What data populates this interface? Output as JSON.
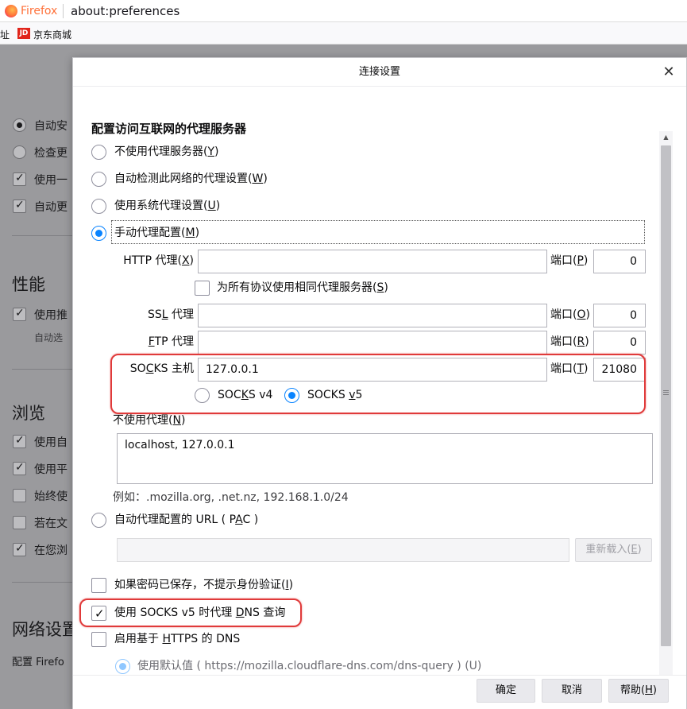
{
  "browser": {
    "brand": "Firefox",
    "url": "about:preferences",
    "bookmark_left": "址",
    "bookmark_jd_icon": "JD",
    "bookmark_jd": "京东商城"
  },
  "background": {
    "items": [
      "自动安",
      "检查更",
      "使用一",
      "自动更"
    ],
    "perf_heading": "性能",
    "perf_item": "使用推",
    "perf_sub": "自动选",
    "browse_heading": "浏览",
    "browse_items": [
      "使用自",
      "使用平",
      "始终使",
      "若在文",
      "在您浏"
    ],
    "net_heading": "网络设置",
    "net_text": "配置 Firefo"
  },
  "dialog": {
    "title": "连接设置",
    "close_glyph": "✕",
    "heading": "配置访问互联网的代理服务器",
    "options": {
      "no_proxy": {
        "text": "不使用代理服务器(",
        "key": "Y",
        "end": ")"
      },
      "auto_detect": {
        "text": "自动检测此网络的代理设置(",
        "key": "W",
        "end": ")"
      },
      "system": {
        "text": "使用系统代理设置(",
        "key": "U",
        "end": ")"
      },
      "manual": {
        "text": "手动代理配置(",
        "key": "M",
        "end": ")"
      }
    },
    "http": {
      "label_a": "HTTP 代理(",
      "key": "X",
      "label_b": ")",
      "host": "",
      "port_label_a": "端口(",
      "port_key": "P",
      "port_label_b": ")",
      "port": "0"
    },
    "same_proxy": {
      "text": "为所有协议使用相同代理服务器(",
      "key": "S",
      "end": ")"
    },
    "ssl": {
      "label_a": "SS",
      "key": "L",
      "label_b": " 代理",
      "host": "",
      "port_label_a": "端口(",
      "port_key": "O",
      "port_label_b": ")",
      "port": "0"
    },
    "ftp": {
      "label_a": "",
      "key": "F",
      "label_b": "TP 代理",
      "host": "",
      "port_label_a": "端口(",
      "port_key": "R",
      "port_label_b": ")",
      "port": "0"
    },
    "socks": {
      "label_a": "SO",
      "key": "C",
      "label_b": "KS 主机",
      "host": "127.0.0.1",
      "port_label_a": "端口(",
      "port_key": "T",
      "port_label_b": ")",
      "port": "21080"
    },
    "socks_v4": {
      "a": "SOC",
      "key": "K",
      "b": "S v4"
    },
    "socks_v5": {
      "a": "SOCKS ",
      "key": "v",
      "b": "5"
    },
    "no_proxy_for": {
      "text": "不使用代理(",
      "key": "N",
      "end": ")"
    },
    "no_proxy_value": "localhost, 127.0.0.1",
    "example": "例如：.mozilla.org, .net.nz, 192.168.1.0/24",
    "pac": {
      "text": "自动代理配置的 URL ( P",
      "key": "A",
      "end": "C )"
    },
    "pac_value": "",
    "reload": {
      "text": "重新载入(",
      "key": "E",
      "end": ")"
    },
    "no_auth_prompt": {
      "text": "如果密码已保存，不提示身份验证(",
      "key": "I",
      "end": ")"
    },
    "socks_dns": {
      "a": "使用 SOCKS v5 时代理 ",
      "key": "D",
      "b": "NS 查询"
    },
    "doh": {
      "a": "启用基于 ",
      "key": "H",
      "b": "TTPS 的 DNS"
    },
    "doh_default": "使用默认值 ( https://mozilla.cloudflare-dns.com/dns-query ) (U)",
    "ok": "确定",
    "cancel": "取消",
    "help": {
      "text": "帮助(",
      "key": "H",
      "end": ")"
    }
  },
  "scrollbar": {
    "up": "▲",
    "down": "▼"
  },
  "colors": {
    "accent": "#0a84ff",
    "highlight": "#e03a3a",
    "firefox_orange": "#ff7139"
  }
}
